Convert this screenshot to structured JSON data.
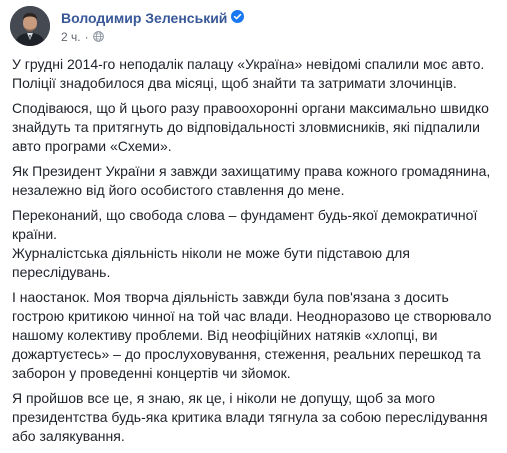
{
  "post": {
    "author": "Володимир Зеленський",
    "time": "2 ч.",
    "separator": "·",
    "verified_icon": "verified-badge-icon",
    "privacy_icon": "globe-icon",
    "accent_color": "#385898",
    "paragraphs": [
      "У грудні 2014-го неподалік палацу «Україна» невідомі спалили моє авто. Поліції знадобилося два місяці, щоб знайти та затримати злочинців.",
      "Сподіваюся, що й цього разу правоохоронні органи максимально швидко знайдуть та притягнуть до відповідальності зловмисників, які підпалили авто програми «Схеми».",
      "Як Президент України я завжди захищатиму права кожного громадянина, незалежно від його особистого ставлення до мене.",
      "Переконаний, що свобода слова – фундамент будь-якої демократичної країни.",
      "Журналістська діяльність ніколи не може бути підставою для переслідувань.",
      "І наостанок. Моя творча діяльність завжди була пов'язана з досить гострою критикою чинної на той час влади. Неодноразово це створювало нашому колективу проблеми. Від неофіційних натяків «хлопці, ви дожартуєтесь» – до прослуховування, стеження, реальних перешкод та заборон у проведенні концертів чи зйомок.",
      "Я пройшов все це, я знаю, як це, і ніколи не допущу, щоб за мого президентства будь-яка критика влади тягнула за собою переслідування або залякування."
    ]
  }
}
